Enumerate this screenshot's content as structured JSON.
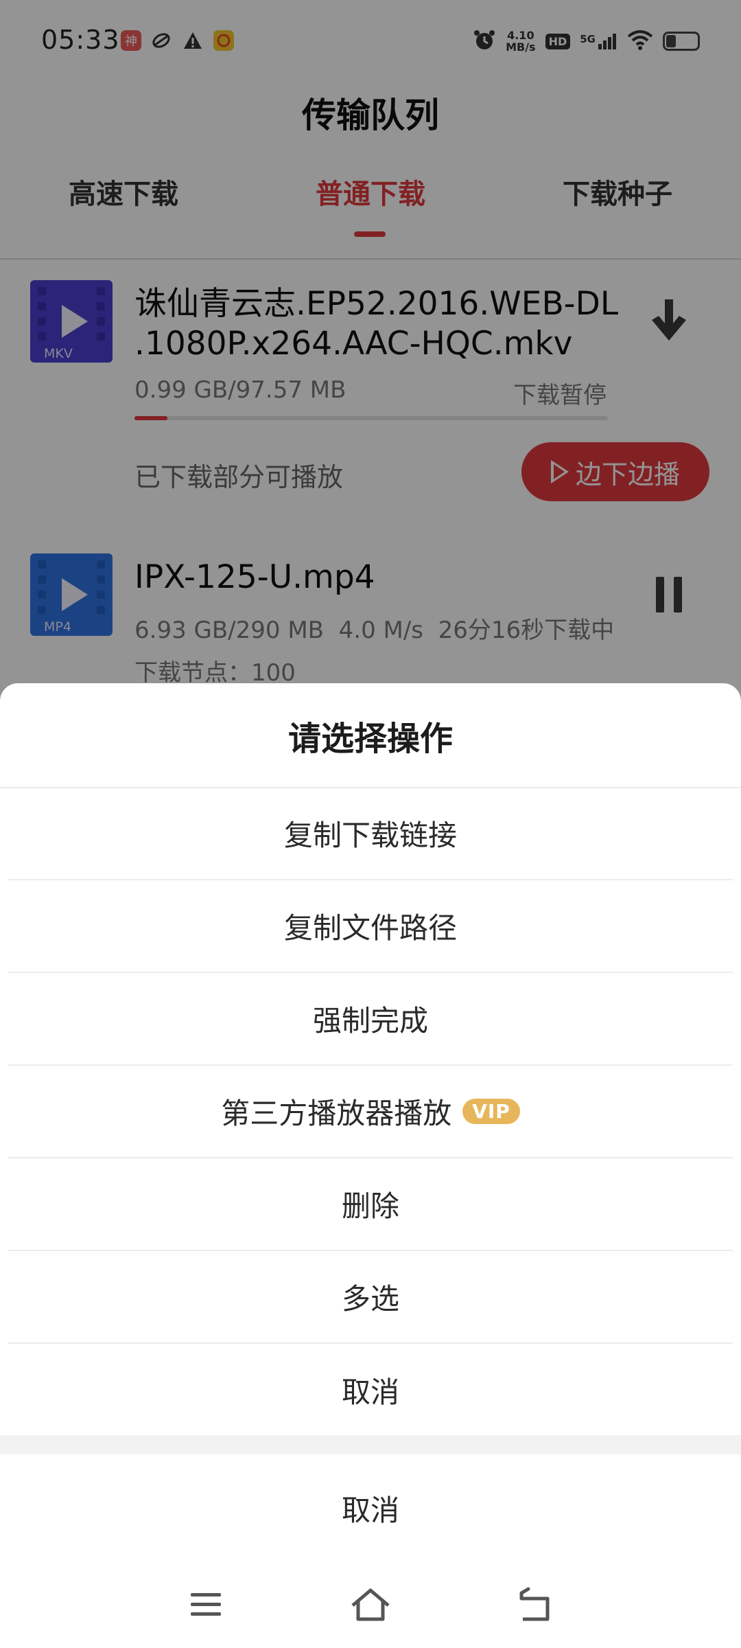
{
  "status_bar": {
    "time": "05:33",
    "speed_value": "4.10",
    "speed_unit": "MB/s",
    "hd": "HD",
    "network": "5G",
    "app_icons": [
      "shen-app-icon",
      "leaf-app-icon",
      "warning-icon",
      "kuaishou-app-icon"
    ],
    "app_icon_text": "神"
  },
  "header": {
    "title": "传输队列",
    "tabs": [
      {
        "label": "高速下载",
        "active": false
      },
      {
        "label": "普通下载",
        "active": true
      },
      {
        "label": "下载种子",
        "active": false
      }
    ]
  },
  "downloads": [
    {
      "name_line1": "诛仙青云志.EP52.2016.WEB-DL",
      "name_line2": ".1080P.x264.AAC-HQC.mkv",
      "ext": "MKV",
      "size": "0.99 GB/97.57 MB",
      "status": "下载暂停",
      "progress": 0.07,
      "hint": "已下载部分可播放",
      "play_label": "边下边播",
      "action_icon": "download-arrow-icon"
    },
    {
      "name": "IPX-125-U.mp4",
      "ext": "MP4",
      "size": "6.93 GB/290 MB",
      "speed": "4.0 M/s",
      "status": "26分16秒下载中",
      "nodes": "下载节点：100",
      "action_icon": "pause-icon"
    }
  ],
  "action_sheet": {
    "title": "请选择操作",
    "items": [
      {
        "label": "复制下载链接"
      },
      {
        "label": "复制文件路径"
      },
      {
        "label": "强制完成"
      },
      {
        "label": "第三方播放器播放",
        "badge": "VIP"
      },
      {
        "label": "删除"
      },
      {
        "label": "多选"
      },
      {
        "label": "取消"
      }
    ],
    "cancel": "取消"
  },
  "nav_bar": {
    "icons": [
      "menu-icon",
      "home-icon",
      "back-icon"
    ]
  },
  "colors": {
    "accent": "#e0393e",
    "vip": "#e7b65a",
    "mkv_thumb": "#4b3fcf",
    "mp4_thumb": "#2f74e4"
  }
}
